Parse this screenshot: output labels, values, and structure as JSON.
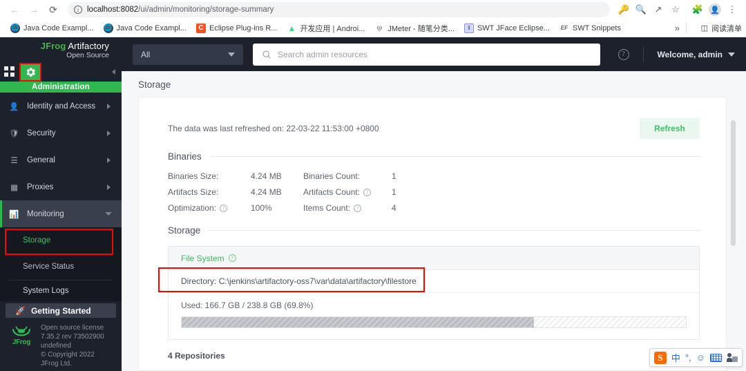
{
  "browser": {
    "nav": {
      "back_icon": "arrow-left-icon",
      "forward_icon": "arrow-right-icon",
      "reload_icon": "reload-icon"
    },
    "omnibox": {
      "info_glyph": "ⓘ",
      "host": "localhost:8082",
      "path": "/ui/admin/monitoring/storage-summary",
      "full_url": "localhost:8082/ui/admin/monitoring/storage-summary"
    },
    "toolbar_icons": [
      "key-icon",
      "zoom-out-icon",
      "share-icon",
      "bookmark-star-icon",
      "extensions-puzzle-icon",
      "profile-avatar-icon",
      "chrome-menu-icon"
    ],
    "bookmarks": [
      {
        "label": "Java Code Exampl...",
        "icon": "globe-icon"
      },
      {
        "label": "Java Code Exampl...",
        "icon": "globe-icon"
      },
      {
        "label": "Eclipse Plug-ins R...",
        "icon": "letter-c-icon"
      },
      {
        "label": "开发应用 | Androi...",
        "icon": "android-icon"
      },
      {
        "label": "JMeter - 随笔分类...",
        "icon": "jmeter-icon"
      },
      {
        "label": "SWT JFace Eclipse...",
        "icon": "swt-icon"
      },
      {
        "label": "SWT Snippets",
        "icon": "ef-icon"
      }
    ],
    "overflow_label": "»",
    "reading_list": {
      "label": "阅读清单",
      "icon": "reading-list-icon"
    }
  },
  "app": {
    "brand": {
      "jfrog": "JFrog",
      "product": "Artifactory",
      "edition": "Open Source"
    },
    "modebar": {
      "grid_icon": "apps-grid-icon",
      "gear_icon": "admin-gear-icon",
      "collapse_icon": "collapse-left-icon"
    },
    "admin_banner": "Administration",
    "menu": [
      {
        "label": "Identity and Access",
        "icon": "user-icon",
        "caret": "right"
      },
      {
        "label": "Security",
        "icon": "shield-icon",
        "caret": "right"
      },
      {
        "label": "General",
        "icon": "sliders-icon",
        "caret": "right"
      },
      {
        "label": "Proxies",
        "icon": "server-icon",
        "caret": "right"
      },
      {
        "label": "Monitoring",
        "icon": "bar-chart-icon",
        "caret": "down",
        "active": true
      }
    ],
    "submenu": [
      {
        "label": "Storage",
        "selected": true
      },
      {
        "label": "Service Status",
        "selected": false
      }
    ],
    "system_logs": "System Logs",
    "getting_started": {
      "label": "Getting Started",
      "icon": "rocket-icon"
    },
    "footer": {
      "logo": "jfrog-logo",
      "lines": [
        "Open source license",
        "7.35.2 rev 73502900",
        "undefined",
        "© Copyright 2022",
        "JFrog Ltd."
      ]
    },
    "topbar": {
      "scope_value": "All",
      "search_placeholder": "Search admin resources",
      "search_value": "",
      "search_icon": "search-icon",
      "help_icon": "help-circle-icon",
      "welcome": "Welcome, admin"
    },
    "page_title": "Storage",
    "refresh_note": "The data was last refreshed on: 22-03-22 11:53:00 +0800",
    "refresh_button": "Refresh",
    "binaries": {
      "section_title": "Binaries",
      "rows": [
        {
          "label": "Binaries Size:",
          "help": false,
          "value": "4.24 MB",
          "label2": "Binaries Count:",
          "help2": false,
          "value2": "1"
        },
        {
          "label": "Artifacts Size:",
          "help": false,
          "value": "4.24 MB",
          "label2": "Artifacts Count:",
          "help2": true,
          "value2": "1"
        },
        {
          "label": "Optimization:",
          "help": true,
          "value": "100%",
          "label2": "Items Count:",
          "help2": true,
          "value2": "4"
        }
      ]
    },
    "storage": {
      "section_title": "Storage",
      "file_system": {
        "title": "File System",
        "help_icon": "help-circle-icon",
        "directory_label": "Directory:",
        "directory_value": "C:\\jenkins\\artifactory-oss7\\var\\data\\artifactory\\filestore",
        "used_text": "Used: 166.7 GB / 238.8 GB (69.8%)",
        "used_percent": 69.8
      },
      "repositories_line": "4 Repositories"
    }
  },
  "ime": {
    "logo": "S",
    "items": [
      "中",
      "°,",
      "smiley-icon",
      "keyboard-icon",
      "user-pad-icon"
    ]
  },
  "colors": {
    "accent_green": "#2fb84f",
    "sidebar_dark": "#1d212b",
    "highlight_red": "#ff0000",
    "refresh_green": "#45c06a"
  }
}
